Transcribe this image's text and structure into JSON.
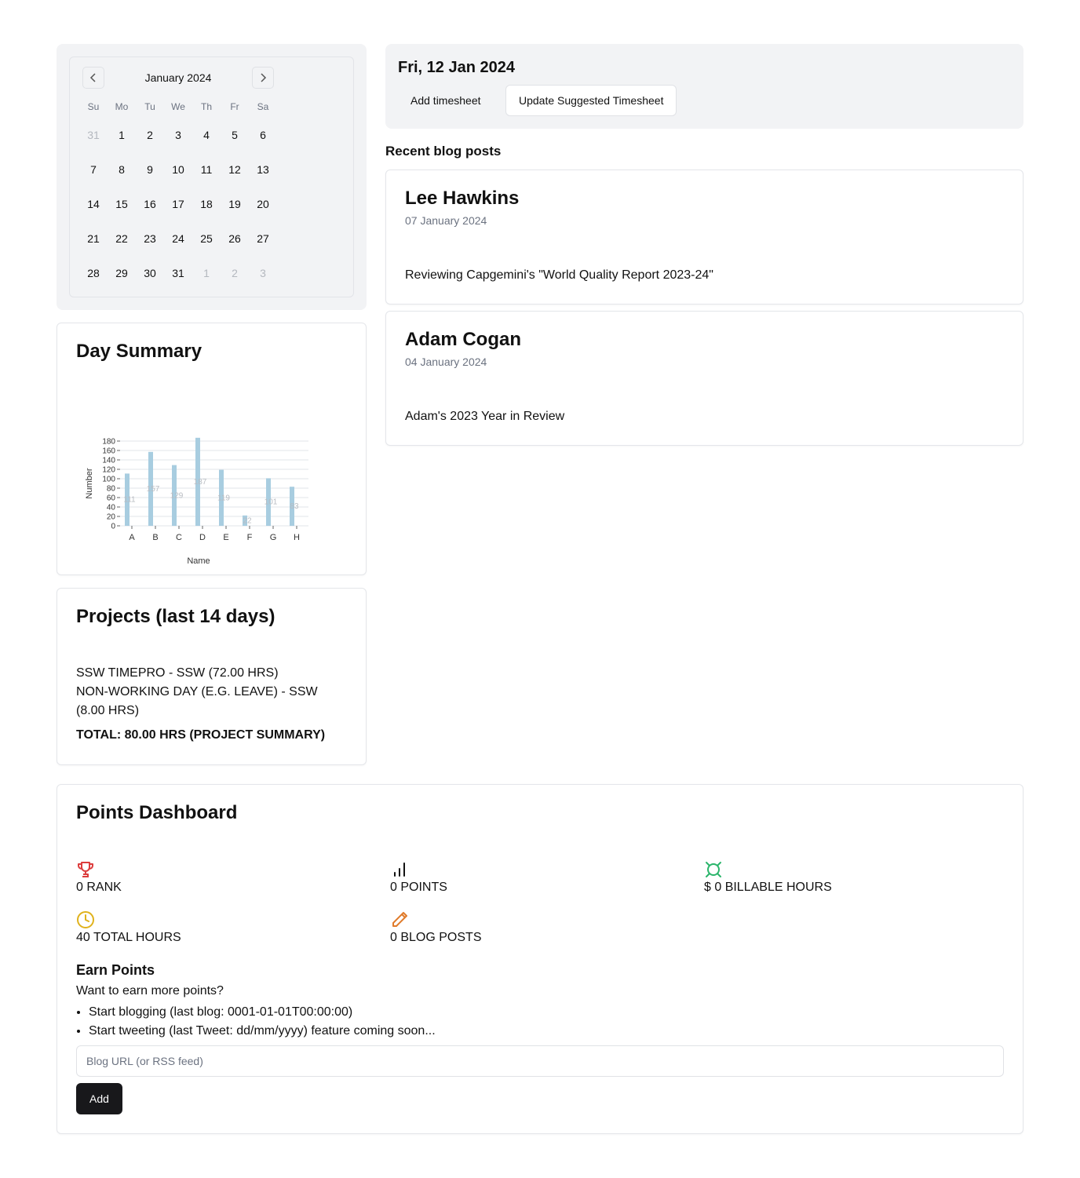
{
  "calendar": {
    "month_label": "January 2024",
    "prev_icon": "chevron-left-icon",
    "next_icon": "chevron-right-icon",
    "weekdays": [
      "Su",
      "Mo",
      "Tu",
      "We",
      "Th",
      "Fr",
      "Sa"
    ],
    "days": [
      {
        "d": "31",
        "out": true
      },
      {
        "d": "1"
      },
      {
        "d": "2"
      },
      {
        "d": "3"
      },
      {
        "d": "4"
      },
      {
        "d": "5"
      },
      {
        "d": "6"
      },
      {
        "d": "7"
      },
      {
        "d": "8"
      },
      {
        "d": "9"
      },
      {
        "d": "10"
      },
      {
        "d": "11"
      },
      {
        "d": "12"
      },
      {
        "d": "13"
      },
      {
        "d": "14"
      },
      {
        "d": "15"
      },
      {
        "d": "16"
      },
      {
        "d": "17"
      },
      {
        "d": "18"
      },
      {
        "d": "19"
      },
      {
        "d": "20"
      },
      {
        "d": "21"
      },
      {
        "d": "22"
      },
      {
        "d": "23"
      },
      {
        "d": "24"
      },
      {
        "d": "25"
      },
      {
        "d": "26"
      },
      {
        "d": "27"
      },
      {
        "d": "28"
      },
      {
        "d": "29"
      },
      {
        "d": "30"
      },
      {
        "d": "31"
      },
      {
        "d": "1",
        "out": true
      },
      {
        "d": "2",
        "out": true
      },
      {
        "d": "3",
        "out": true
      }
    ]
  },
  "header": {
    "date": "Fri, 12 Jan 2024",
    "add_timesheet": "Add timesheet",
    "update_timesheet": "Update Suggested Timesheet"
  },
  "blog": {
    "section_title": "Recent blog posts",
    "posts": [
      {
        "author": "Lee Hawkins",
        "date": "07 January 2024",
        "title": "Reviewing Capgemini's \"World Quality Report 2023-24\""
      },
      {
        "author": "Adam Cogan",
        "date": "04 January 2024",
        "title": "Adam's 2023 Year in Review"
      }
    ]
  },
  "day_summary": {
    "title": "Day Summary"
  },
  "chart_data": {
    "type": "bar",
    "categories": [
      "A",
      "B",
      "C",
      "D",
      "E",
      "F",
      "G",
      "H"
    ],
    "values": [
      111,
      157,
      129,
      187,
      119,
      22,
      101,
      83
    ],
    "xlabel": "Name",
    "ylabel": "Number",
    "yticks": [
      0,
      20,
      40,
      60,
      80,
      100,
      120,
      140,
      160,
      180
    ],
    "ylim": [
      0,
      180
    ],
    "grid": true,
    "bar_color": "#a8cde0"
  },
  "projects": {
    "title": "Projects (last 14 days)",
    "items": [
      "SSW TIMEPRO - SSW (72.00 HRS)",
      "NON-WORKING DAY (E.G. LEAVE) - SSW (8.00 HRS)"
    ],
    "total": "TOTAL: 80.00 HRS (PROJECT SUMMARY)"
  },
  "points": {
    "title": "Points Dashboard",
    "stats": {
      "rank": {
        "label": "0 RANK",
        "icon": "trophy-icon",
        "color": "#dc3c3c"
      },
      "points": {
        "label": "0 POINTS",
        "icon": "bar-chart-icon",
        "color": "#111111"
      },
      "billable": {
        "label": "$ 0 BILLABLE HOURS",
        "icon": "currency-icon",
        "color": "#2bb56b"
      },
      "total_hours": {
        "label": "40 TOTAL HOURS",
        "icon": "clock-icon",
        "color": "#e0b21c"
      },
      "blog_posts": {
        "label": "0 BLOG POSTS",
        "icon": "pencil-icon",
        "color": "#e07a2a"
      }
    },
    "earn_title": "Earn Points",
    "earn_subtitle": "Want to earn more points?",
    "earn_items": [
      "Start blogging (last blog: 0001-01-01T00:00:00)",
      "Start tweeting (last Tweet: dd/mm/yyyy) feature coming soon..."
    ],
    "input_placeholder": "Blog URL (or RSS feed)",
    "add_label": "Add"
  }
}
